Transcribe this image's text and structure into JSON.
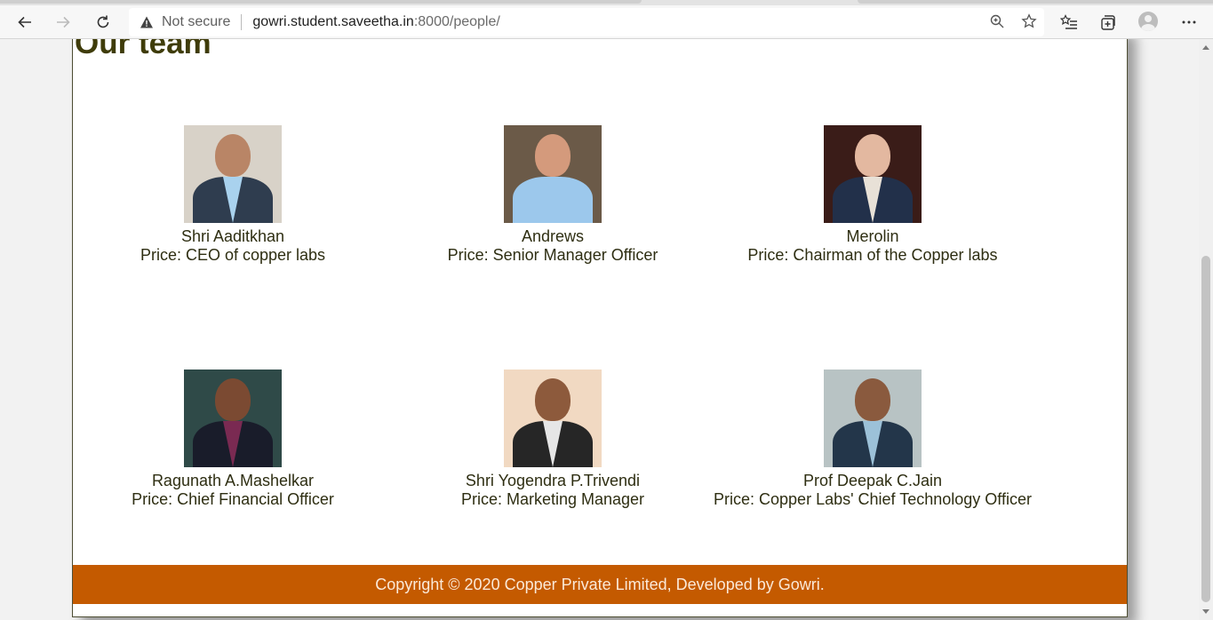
{
  "browser": {
    "security_label": "Not secure",
    "url_host": "gowri.student.saveetha.in",
    "url_rest": ":8000/people/"
  },
  "page": {
    "title": "Our team",
    "members": [
      {
        "name": "Shri Aaditkhan",
        "role": "Price: CEO of copper labs"
      },
      {
        "name": "Andrews",
        "role": "Price: Senior Manager Officer"
      },
      {
        "name": "Merolin",
        "role": "Price: Chairman of the Copper labs"
      },
      {
        "name": "Ragunath A.Mashelkar",
        "role": "Price: Chief Financial Officer"
      },
      {
        "name": "Shri Yogendra P.Trivendi",
        "role": "Price: Marketing Manager"
      },
      {
        "name": "Prof Deepak C.Jain",
        "role": "Price: Copper Labs' Chief Technology Officer"
      }
    ],
    "footer": "Copyright © 2020 Copper Private Limited, Developed by Gowri."
  },
  "colors": {
    "title": "#3f3c0a",
    "footer_bg": "#c45a00",
    "text": "#2e2e12"
  }
}
